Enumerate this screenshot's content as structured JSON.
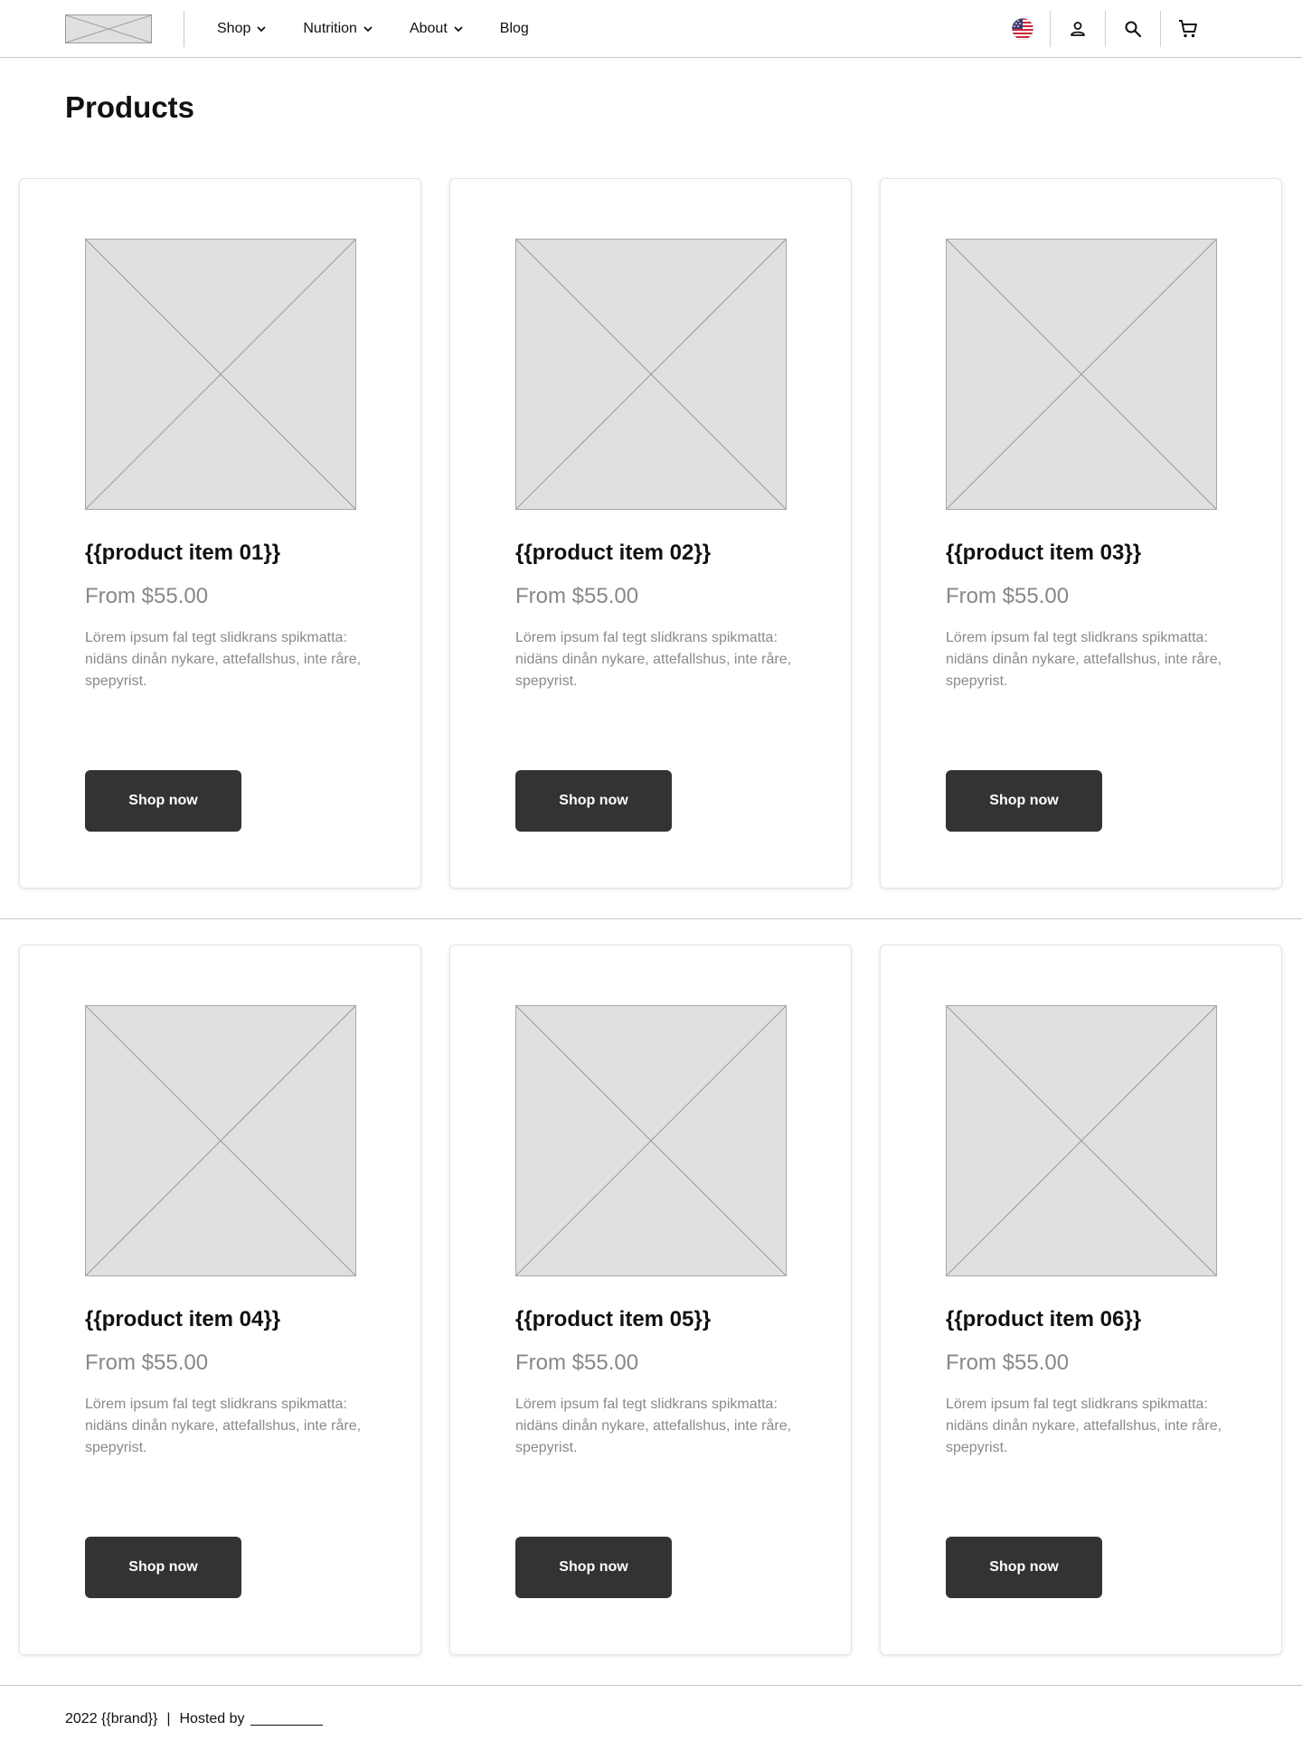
{
  "header": {
    "nav": [
      {
        "label": "Shop",
        "has_dropdown": true
      },
      {
        "label": "Nutrition",
        "has_dropdown": true
      },
      {
        "label": "About",
        "has_dropdown": true
      },
      {
        "label": "Blog",
        "has_dropdown": false
      }
    ],
    "actions": [
      "us-flag-icon",
      "user-icon",
      "search-icon",
      "cart-icon"
    ]
  },
  "page": {
    "title": "Products"
  },
  "products": [
    {
      "title": "{{product item 01}}",
      "price": "From $55.00",
      "description": "Lörem ipsum fal tegt slidkrans spikmatta: nidäns dinån nykare, attefallshus, inte råre, spepyrist.",
      "button": "Shop now"
    },
    {
      "title": "{{product item 02}}",
      "price": "From $55.00",
      "description": "Lörem ipsum fal tegt slidkrans spikmatta: nidäns dinån nykare, attefallshus, inte råre, spepyrist.",
      "button": "Shop now"
    },
    {
      "title": "{{product item 03}}",
      "price": "From $55.00",
      "description": "Lörem ipsum fal tegt slidkrans spikmatta: nidäns dinån nykare, attefallshus, inte råre, spepyrist.",
      "button": "Shop now"
    },
    {
      "title": "{{product item 04}}",
      "price": "From $55.00",
      "description": "Lörem ipsum fal tegt slidkrans spikmatta: nidäns dinån nykare, attefallshus, inte råre, spepyrist.",
      "button": "Shop now"
    },
    {
      "title": "{{product item 05}}",
      "price": "From $55.00",
      "description": "Lörem ipsum fal tegt slidkrans spikmatta: nidäns dinån nykare, attefallshus, inte råre, spepyrist.",
      "button": "Shop now"
    },
    {
      "title": "{{product item 06}}",
      "price": "From $55.00",
      "description": "Lörem ipsum fal tegt slidkrans spikmatta: nidäns dinån nykare, attefallshus, inte råre, spepyrist.",
      "button": "Shop now"
    }
  ],
  "footer": {
    "year_brand": "2022 {{brand}}",
    "separator": "|",
    "hosted_by": "Hosted by"
  },
  "colors": {
    "button_bg": "#333333",
    "placeholder_bg": "#e0e0e0",
    "muted_text": "#888888",
    "divider": "#c8c8c8"
  }
}
